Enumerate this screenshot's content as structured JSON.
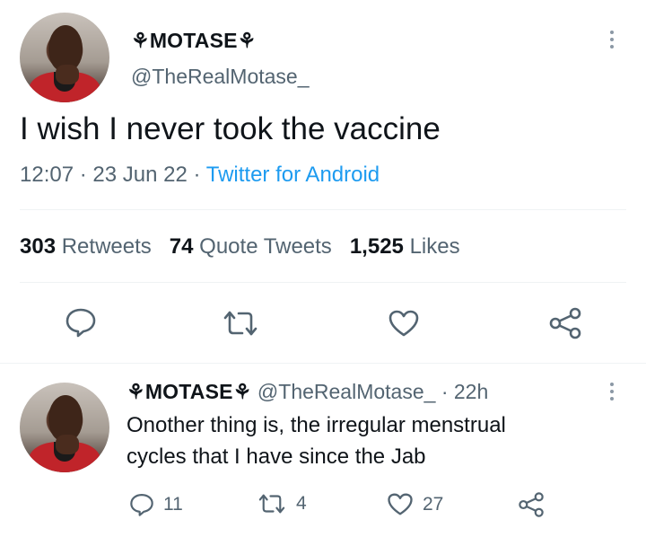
{
  "tweet": {
    "author_name": "⚘MOTASE⚘",
    "author_handle": "@TheRealMotase_",
    "text": "I wish I never took the vaccine",
    "time": "12:07",
    "date": "23 Jun 22",
    "source": "Twitter for Android",
    "retweets_count": "303",
    "retweets_label": "Retweets",
    "quotes_count": "74",
    "quotes_label": "Quote Tweets",
    "likes_count": "1,525",
    "likes_label": "Likes"
  },
  "reply": {
    "author_name": "⚘MOTASE⚘",
    "author_handle": "@TheRealMotase_",
    "age": "· 22h",
    "text_line1": "Onother thing is, the irregular menstrual",
    "text_line2": "cycles that I have since the Jab",
    "reply_count": "11",
    "retweet_count": "4",
    "like_count": "27"
  },
  "colors": {
    "text": "#0f1419",
    "secondary": "#536471",
    "link": "#1d9bf0",
    "divider": "#eff3f4"
  }
}
